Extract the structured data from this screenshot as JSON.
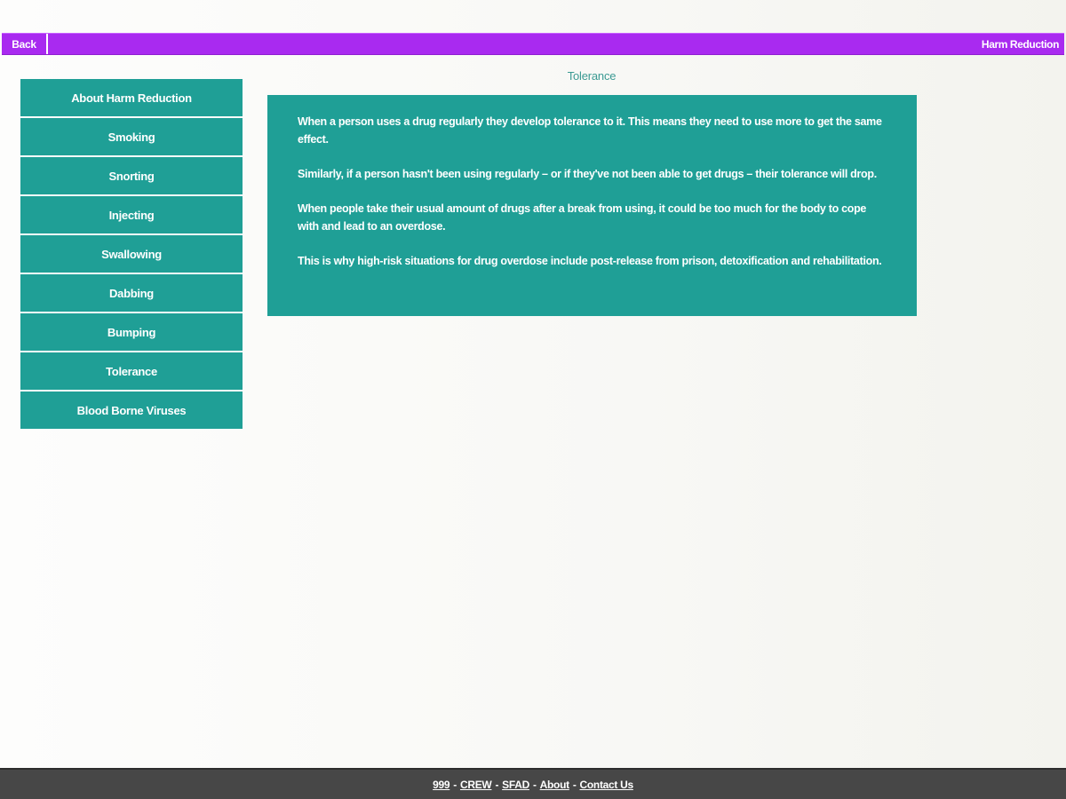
{
  "header": {
    "back_label": "Back",
    "title": "Harm Reduction",
    "color": "#a92af0"
  },
  "sidebar": {
    "items": [
      {
        "label": "About Harm Reduction"
      },
      {
        "label": "Smoking"
      },
      {
        "label": "Snorting"
      },
      {
        "label": "Injecting"
      },
      {
        "label": "Swallowing"
      },
      {
        "label": "Dabbing"
      },
      {
        "label": "Bumping"
      },
      {
        "label": "Tolerance"
      },
      {
        "label": "Blood Borne Viruses"
      }
    ],
    "color": "#1f9f96"
  },
  "main": {
    "title": "Tolerance",
    "paragraphs": [
      "When a person uses a drug regularly they develop tolerance to it. This means they need to use more to get the same effect.",
      "Similarly, if a person hasn't been using regularly – or if they've not been able to get drugs – their tolerance will drop.",
      "When people take their usual amount of drugs after a break from using, it could be too much for the body to cope with and lead to an overdose.",
      "This is why high-risk situations for drug overdose include post-release from prison, detoxification and rehabilitation."
    ]
  },
  "footer": {
    "links": [
      "999",
      "CREW",
      "SFAD",
      "About",
      "Contact Us"
    ],
    "separator": "-"
  }
}
